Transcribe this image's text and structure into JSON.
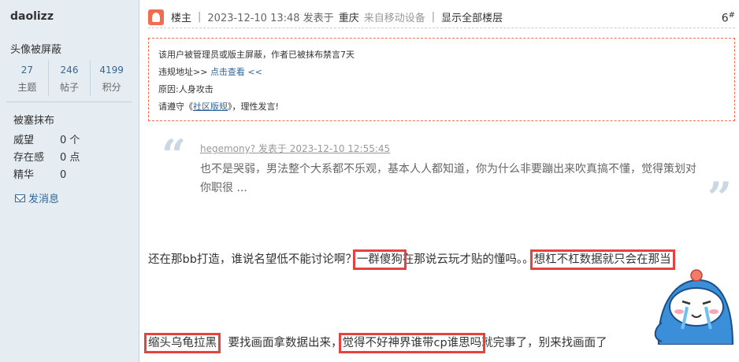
{
  "sidebar": {
    "username": "daolizz",
    "avatar_status": "头像被屏蔽",
    "stats": [
      {
        "value": "27",
        "label": "主题"
      },
      {
        "value": "246",
        "label": "帖子"
      },
      {
        "value": "4199",
        "label": "积分"
      }
    ],
    "group": "被塞抹布",
    "props": [
      {
        "key": "威望",
        "value": "0 个"
      },
      {
        "key": "存在感",
        "value": "0 点"
      },
      {
        "key": "精华",
        "value": "0"
      }
    ],
    "message_label": "发消息"
  },
  "header": {
    "role": "楼主",
    "date": "2023-12-10 13:48 发表于",
    "location": "重庆",
    "device": "来自移动设备",
    "show_all": "显示全部楼层",
    "floor": "6",
    "floor_sup": "#"
  },
  "notice": {
    "line1": "该用户被管理员或版主屏蔽，作者已被抹布禁言7天",
    "line2_prefix": "违规地址>>",
    "line2_link": "点击查看 <<",
    "line3": "原因:人身攻击",
    "line4_prefix": "请遵守《",
    "line4_link": "社区版规",
    "line4_suffix": "》，理性发言!"
  },
  "quote": {
    "author": "hegemony?  发表于 2023-12-10 12:55:45",
    "body": "也不是哭弱，男法整个大系都不乐观，基本人人都知道，你为什么非要蹦出来吹真搞不懂，觉得策划对你职很 ..."
  },
  "post": {
    "line1_a": "还在那bb打造，谁说名望低不能讨论啊？",
    "line1_hl1": "一群傻狗",
    "line1_b": "在那说云玩才贴的懂吗。。",
    "line1_hl2": "想杠不杠数据就只会在那当",
    "line2_hl1": "缩头乌龟拉黑",
    "line2_a": "，要找画面拿数据出来，",
    "line2_hl2": "觉得不好神界谁带cp谁思吗",
    "line2_b": "就完事了，别来找画面了"
  },
  "colors": {
    "sidebar_bg": "#e5edf2",
    "link": "#336699",
    "highlight": "#e8423f",
    "badge": "#f26c4f"
  }
}
